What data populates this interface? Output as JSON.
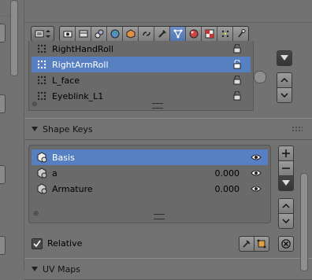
{
  "vertex_groups": {
    "items": [
      {
        "name": "RightHandRoll",
        "selected": false
      },
      {
        "name": "RightArmRoll",
        "selected": true
      },
      {
        "name": "L_face",
        "selected": false
      },
      {
        "name": "Eyeblink_L1",
        "selected": false
      }
    ]
  },
  "shape_keys": {
    "title": "Shape Keys",
    "items": [
      {
        "name": "Basis",
        "value": "",
        "selected": true
      },
      {
        "name": "a",
        "value": "0.000",
        "selected": false
      },
      {
        "name": "Armature",
        "value": "0.000",
        "selected": false
      }
    ],
    "relative_label": "Relative",
    "relative_checked": true
  },
  "uv_maps": {
    "title": "UV Maps"
  },
  "context_tabs": [
    "render-icon",
    "scene-icon",
    "render-layers-icon",
    "world-icon",
    "object-icon",
    "constraints-icon",
    "modifiers-icon",
    "data-icon",
    "material-icon",
    "texture-icon",
    "particles-icon"
  ],
  "active_tab": "data-icon",
  "colors": {
    "selection": "#5680c2",
    "panel_bg": "#727272"
  }
}
